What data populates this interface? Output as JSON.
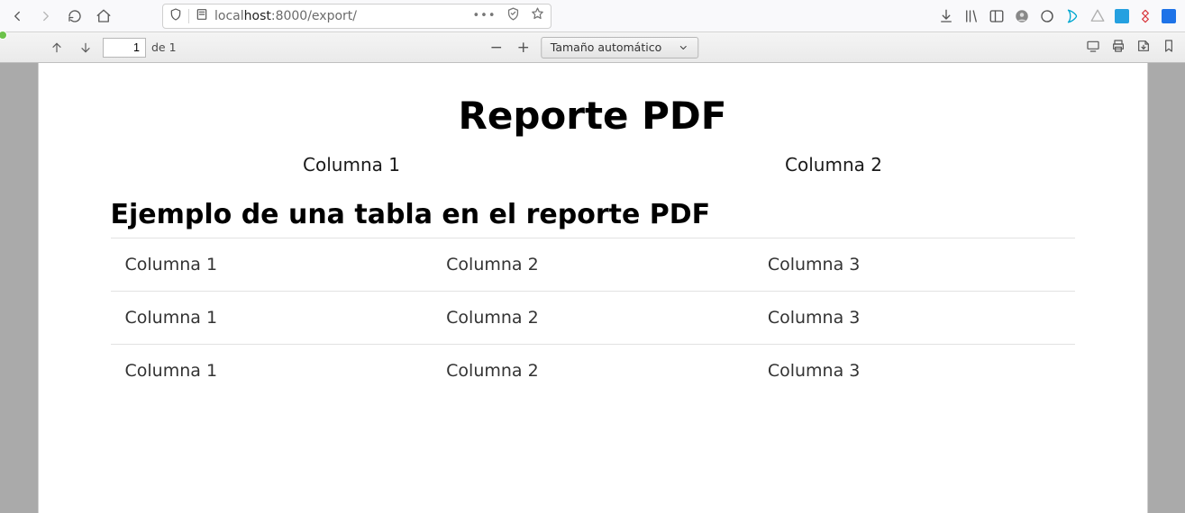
{
  "browser": {
    "url_prefix": "local",
    "url_host": "host",
    "url_port_path": ":8000/export/"
  },
  "pdfbar": {
    "page_current": "1",
    "page_of_label": "de 1",
    "zoom_label": "Tamaño automático"
  },
  "document": {
    "title": "Reporte PDF",
    "top_columns": [
      "Columna 1",
      "Columna 2"
    ],
    "subtitle": "Ejemplo de una tabla en el reporte PDF",
    "table": {
      "rows": [
        [
          "Columna 1",
          "Columna 2",
          "Columna 3"
        ],
        [
          "Columna 1",
          "Columna 2",
          "Columna 3"
        ],
        [
          "Columna 1",
          "Columna 2",
          "Columna 3"
        ]
      ]
    }
  }
}
